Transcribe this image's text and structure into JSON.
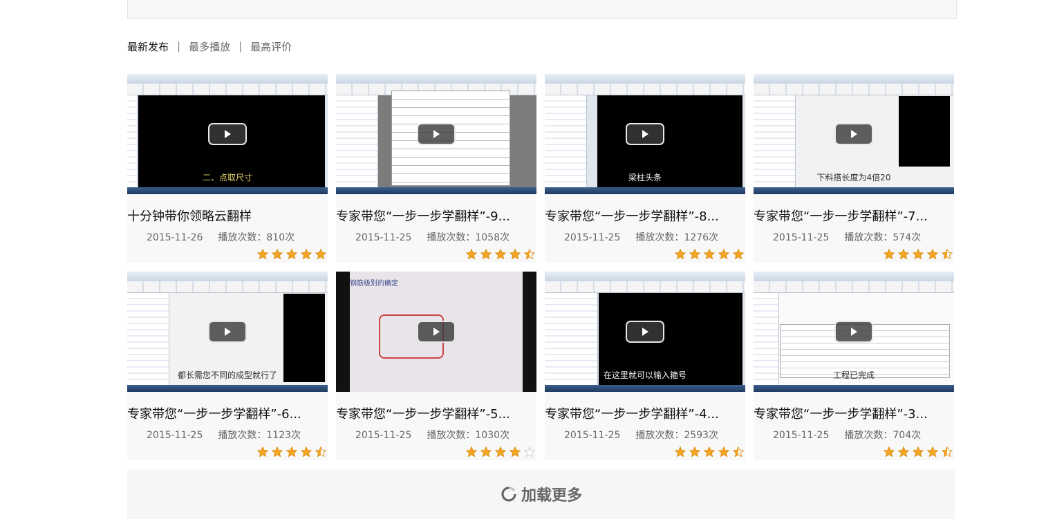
{
  "sort_tabs": [
    {
      "label": "最新发布",
      "active": true
    },
    {
      "label": "最多播放",
      "active": false
    },
    {
      "label": "最高评价",
      "active": false
    }
  ],
  "separator": "|",
  "count_label": "播放次数：",
  "count_suffix": "次",
  "videos": [
    {
      "title": "十分钟带你领略云翻样",
      "date": "2015-11-26",
      "plays": "810",
      "rating": 5,
      "caption": "二、点取尺寸"
    },
    {
      "title": "专家带您“一步一步学翻样”-9...",
      "date": "2015-11-25",
      "plays": "1058",
      "rating": 4.5,
      "caption": ""
    },
    {
      "title": "专家带您“一步一步学翻样”-8...",
      "date": "2015-11-25",
      "plays": "1276",
      "rating": 5,
      "caption": "梁柱头条"
    },
    {
      "title": "专家带您“一步一步学翻样”-7...",
      "date": "2015-11-25",
      "plays": "574",
      "rating": 4.5,
      "caption": "下料搭长度为4倍20"
    },
    {
      "title": "专家带您“一步一步学翻样”-6...",
      "date": "2015-11-25",
      "plays": "1123",
      "rating": 4.5,
      "caption": "都长需您不同的成型就行了"
    },
    {
      "title": "专家带您“一步一步学翻样”-5...",
      "date": "2015-11-25",
      "plays": "1030",
      "rating": 4,
      "caption": "钢筋级别的确定"
    },
    {
      "title": "专家带您“一步一步学翻样”-4...",
      "date": "2015-11-25",
      "plays": "2593",
      "rating": 4.5,
      "caption": "在这里就可以输入箍号"
    },
    {
      "title": "专家带您“一步一步学翻样”-3...",
      "date": "2015-11-25",
      "plays": "704",
      "rating": 4.5,
      "caption": "工程已完成"
    }
  ],
  "load_more": {
    "label": "加载更多",
    "icon": "refresh-icon"
  },
  "colors": {
    "star": "#f5a623",
    "star_empty": "#cccccc",
    "card_bg": "#f8f8f8"
  }
}
